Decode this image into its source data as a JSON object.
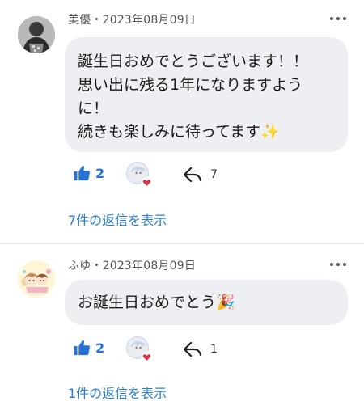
{
  "comments": [
    {
      "author": "美優",
      "date": "2023年08月09日",
      "text_lines": [
        "誕生日おめでとうございます！！",
        "思い出に残る1年になりますよう",
        "に！",
        "続きも楽しみに待ってます✨"
      ],
      "likes": "2",
      "shares": "7",
      "replies_label": "7件の返信を表示"
    },
    {
      "author": "ふゆ",
      "date": "2023年08月09日",
      "text_lines": [
        "お誕生日おめでとう🎉"
      ],
      "likes": "2",
      "shares": "1",
      "replies_label": "1件の返信を表示"
    }
  ],
  "separator": "・",
  "icons": {
    "more": "more-horizontal-icon",
    "like": "thumbs-up-icon",
    "share": "reply-arrow-icon",
    "heart": "heart-icon"
  },
  "colors": {
    "accent": "#2573d8",
    "link": "#2a7fd4",
    "bubble": "#eeeff2",
    "heart": "#e0344a"
  }
}
